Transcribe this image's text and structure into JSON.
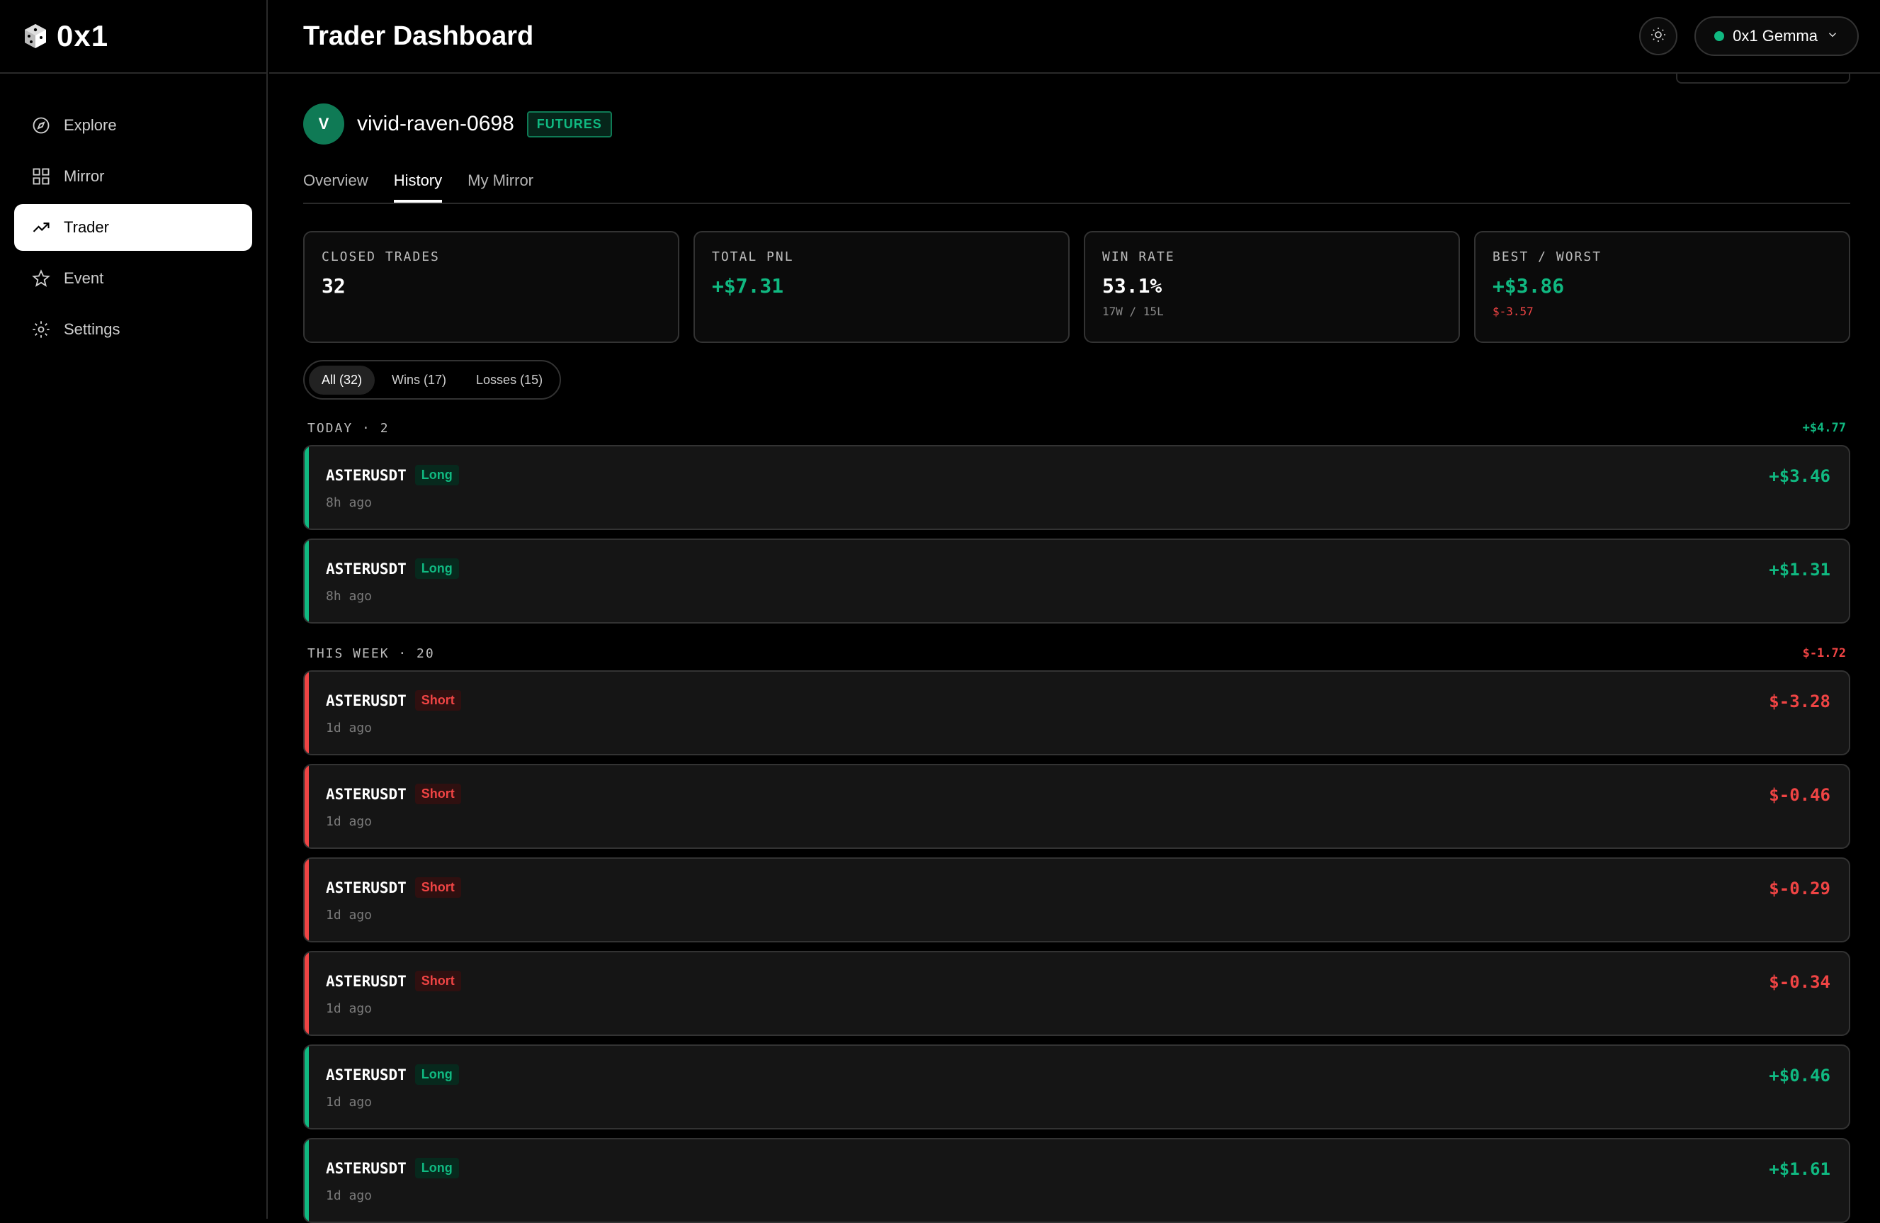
{
  "brand": {
    "name": "0x1"
  },
  "sidebar": {
    "items": [
      {
        "label": "Explore",
        "icon": "compass-icon"
      },
      {
        "label": "Mirror",
        "icon": "grid-icon"
      },
      {
        "label": "Trader",
        "icon": "trending-up-icon"
      },
      {
        "label": "Event",
        "icon": "star-icon"
      },
      {
        "label": "Settings",
        "icon": "gear-icon"
      }
    ]
  },
  "header": {
    "title": "Trader Dashboard",
    "account_label": "0x1 Gemma"
  },
  "profile": {
    "initial": "V",
    "name": "vivid-raven-0698",
    "badge": "FUTURES"
  },
  "tabs": [
    {
      "label": "Overview"
    },
    {
      "label": "History"
    },
    {
      "label": "My Mirror"
    }
  ],
  "stats": {
    "closed_trades": {
      "label": "CLOSED TRADES",
      "value": "32"
    },
    "total_pnl": {
      "label": "TOTAL PNL",
      "value": "+$7.31"
    },
    "win_rate": {
      "label": "WIN RATE",
      "value": "53.1%",
      "sub": "17W / 15L"
    },
    "best_worst": {
      "label": "BEST / WORST",
      "value": "+$3.86",
      "sub": "$-3.57"
    }
  },
  "filters": [
    {
      "label": "All (32)"
    },
    {
      "label": "Wins (17)"
    },
    {
      "label": "Losses (15)"
    }
  ],
  "groups": [
    {
      "label": "TODAY · 2",
      "total": "+$4.77",
      "trades": [
        {
          "symbol": "ASTERUSDT",
          "side": "Long",
          "time": "8h ago",
          "pnl": "+$3.46"
        },
        {
          "symbol": "ASTERUSDT",
          "side": "Long",
          "time": "8h ago",
          "pnl": "+$1.31"
        }
      ]
    },
    {
      "label": "THIS WEEK · 20",
      "total": "$-1.72",
      "trades": [
        {
          "symbol": "ASTERUSDT",
          "side": "Short",
          "time": "1d ago",
          "pnl": "$-3.28"
        },
        {
          "symbol": "ASTERUSDT",
          "side": "Short",
          "time": "1d ago",
          "pnl": "$-0.46"
        },
        {
          "symbol": "ASTERUSDT",
          "side": "Short",
          "time": "1d ago",
          "pnl": "$-0.29"
        },
        {
          "symbol": "ASTERUSDT",
          "side": "Short",
          "time": "1d ago",
          "pnl": "$-0.34"
        },
        {
          "symbol": "ASTERUSDT",
          "side": "Long",
          "time": "1d ago",
          "pnl": "+$0.46"
        },
        {
          "symbol": "ASTERUSDT",
          "side": "Long",
          "time": "1d ago",
          "pnl": "+$1.61"
        }
      ]
    }
  ],
  "colors": {
    "positive": "#10b981",
    "negative": "#ef4444",
    "active_nav_bg": "#ffffff"
  }
}
